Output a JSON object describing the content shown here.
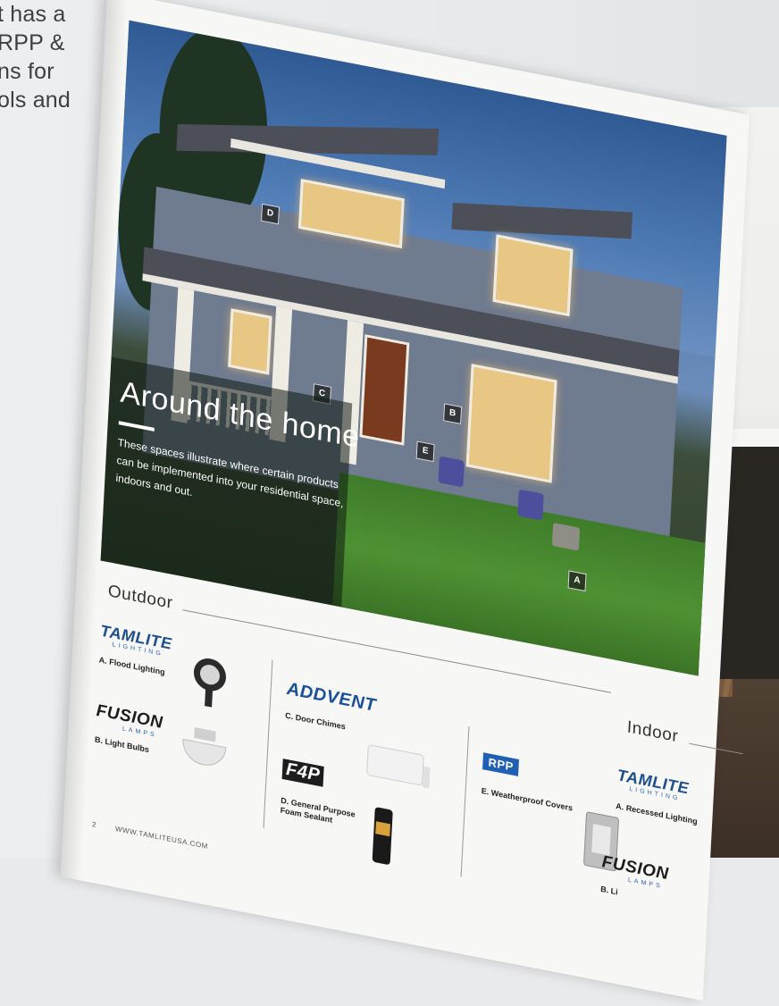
{
  "background_text": [
    "t has a",
    " RPP &",
    "ns for",
    "ols and"
  ],
  "photo": {
    "overlay_title": "Around the home",
    "overlay_description": "These spaces illustrate where certain products can be implemented into your residential space, indoors and out.",
    "markers": [
      "D",
      "C",
      "B",
      "E",
      "A"
    ]
  },
  "outdoor": {
    "title": "Outdoor",
    "items": [
      {
        "brand": "TAMLITE",
        "brand_sub": "LIGHTING",
        "label": "A. Flood Lighting"
      },
      {
        "brand": "FUSION",
        "brand_sub": "LAMPS",
        "label": "B. Light Bulbs"
      },
      {
        "brand": "ADDVENT",
        "label": "C. Door Chimes"
      },
      {
        "brand": "F4P",
        "label": "D. General Purpose Foam Sealant"
      },
      {
        "brand": "RPP",
        "label": "E. Weatherproof Covers"
      }
    ]
  },
  "indoor": {
    "title": "Indoor",
    "items": [
      {
        "brand": "TAMLITE",
        "brand_sub": "LIGHTING",
        "label": "A. Recessed Lighting"
      },
      {
        "brand": "FUSION",
        "brand_sub": "LAMPS",
        "label": "B. Li"
      }
    ]
  },
  "footer": {
    "page_number": "2",
    "website": "WWW.TAMLITEUSA.COM"
  },
  "colors": {
    "brand_blue": "#1f4f8f",
    "page": "#f7f7f6",
    "overlay": "#0f1912"
  }
}
